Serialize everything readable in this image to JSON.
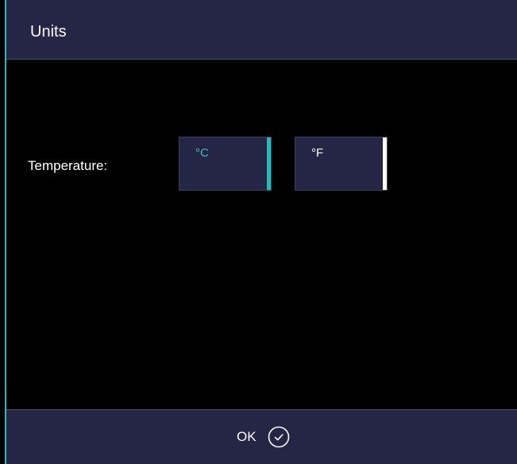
{
  "window": {
    "title": "Units"
  },
  "temperature": {
    "label": "Temperature:",
    "options": [
      {
        "label": "°C",
        "selected": true,
        "text_color": "#2bc3c0",
        "bar_color": "#2bb7b3"
      },
      {
        "label": "°F",
        "selected": false,
        "text_color": "#ffffff",
        "bar_color": "#ffffff"
      }
    ]
  },
  "footer": {
    "ok_label": "OK",
    "ok_icon": "check-circle-icon"
  },
  "colors": {
    "accent": "#2bb7b3",
    "panel": "#252545",
    "background": "#000000"
  }
}
